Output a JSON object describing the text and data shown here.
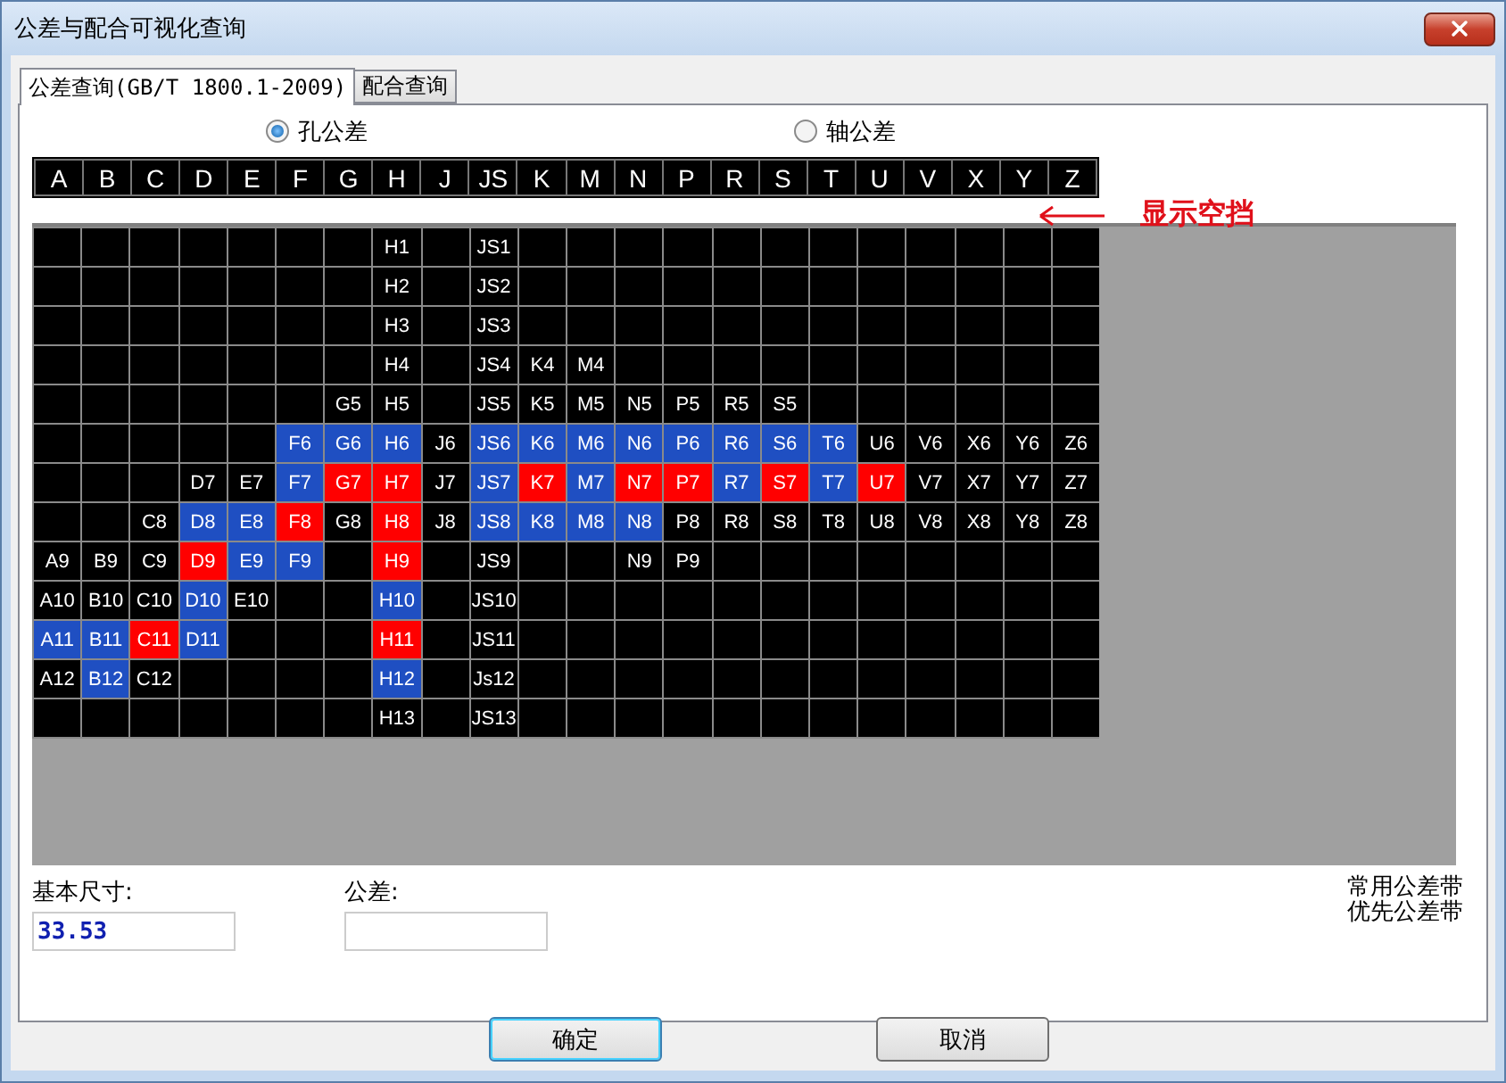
{
  "window": {
    "title": "公差与配合可视化查询"
  },
  "tabs": [
    {
      "label": "公差查询(GB/T 1800.1-2009)",
      "selected": true
    },
    {
      "label": "配合查询",
      "selected": false
    }
  ],
  "radios": [
    {
      "label": "孔公差",
      "selected": true
    },
    {
      "label": "轴公差",
      "selected": false
    }
  ],
  "letters": [
    "A",
    "B",
    "C",
    "D",
    "E",
    "F",
    "G",
    "H",
    "J",
    "JS",
    "K",
    "M",
    "N",
    "P",
    "R",
    "S",
    "T",
    "U",
    "V",
    "X",
    "Y",
    "Z"
  ],
  "annotation": {
    "text": "显示空挡"
  },
  "grid_rows": [
    [
      null,
      null,
      null,
      null,
      null,
      null,
      null,
      {
        "text": "H1",
        "color": "#000000"
      },
      null,
      {
        "text": "JS1",
        "color": "#000000"
      },
      null,
      null,
      null,
      null,
      null,
      null,
      null,
      null,
      null,
      null,
      null,
      null
    ],
    [
      null,
      null,
      null,
      null,
      null,
      null,
      null,
      {
        "text": "H2",
        "color": "#000000"
      },
      null,
      {
        "text": "JS2",
        "color": "#000000"
      },
      null,
      null,
      null,
      null,
      null,
      null,
      null,
      null,
      null,
      null,
      null,
      null
    ],
    [
      null,
      null,
      null,
      null,
      null,
      null,
      null,
      {
        "text": "H3",
        "color": "#000000"
      },
      null,
      {
        "text": "JS3",
        "color": "#000000"
      },
      null,
      null,
      null,
      null,
      null,
      null,
      null,
      null,
      null,
      null,
      null,
      null
    ],
    [
      null,
      null,
      null,
      null,
      null,
      null,
      null,
      {
        "text": "H4",
        "color": "#000000"
      },
      null,
      {
        "text": "JS4",
        "color": "#000000"
      },
      {
        "text": "K4",
        "color": "#000000"
      },
      {
        "text": "M4",
        "color": "#000000"
      },
      null,
      null,
      null,
      null,
      null,
      null,
      null,
      null,
      null,
      null
    ],
    [
      null,
      null,
      null,
      null,
      null,
      null,
      {
        "text": "G5",
        "color": "#000000"
      },
      {
        "text": "H5",
        "color": "#000000"
      },
      null,
      {
        "text": "JS5",
        "color": "#000000"
      },
      {
        "text": "K5",
        "color": "#000000"
      },
      {
        "text": "M5",
        "color": "#000000"
      },
      {
        "text": "N5",
        "color": "#000000"
      },
      {
        "text": "P5",
        "color": "#000000"
      },
      {
        "text": "R5",
        "color": "#000000"
      },
      {
        "text": "S5",
        "color": "#000000"
      },
      null,
      null,
      null,
      null,
      null,
      null
    ],
    [
      null,
      null,
      null,
      null,
      null,
      {
        "text": "F6",
        "color": "#1f4fc2"
      },
      {
        "text": "G6",
        "color": "#1f4fc2"
      },
      {
        "text": "H6",
        "color": "#1f4fc2"
      },
      {
        "text": "J6",
        "color": "#000000"
      },
      {
        "text": "JS6",
        "color": "#1f4fc2"
      },
      {
        "text": "K6",
        "color": "#1f4fc2"
      },
      {
        "text": "M6",
        "color": "#1f4fc2"
      },
      {
        "text": "N6",
        "color": "#1f4fc2"
      },
      {
        "text": "P6",
        "color": "#1f4fc2"
      },
      {
        "text": "R6",
        "color": "#1f4fc2"
      },
      {
        "text": "S6",
        "color": "#1f4fc2"
      },
      {
        "text": "T6",
        "color": "#1f4fc2"
      },
      {
        "text": "U6",
        "color": "#000000"
      },
      {
        "text": "V6",
        "color": "#000000"
      },
      {
        "text": "X6",
        "color": "#000000"
      },
      {
        "text": "Y6",
        "color": "#000000"
      },
      {
        "text": "Z6",
        "color": "#000000"
      }
    ],
    [
      null,
      null,
      null,
      {
        "text": "D7",
        "color": "#000000"
      },
      {
        "text": "E7",
        "color": "#000000"
      },
      {
        "text": "F7",
        "color": "#1f4fc2"
      },
      {
        "text": "G7",
        "color": "#ff0000"
      },
      {
        "text": "H7",
        "color": "#ff0000"
      },
      {
        "text": "J7",
        "color": "#000000"
      },
      {
        "text": "JS7",
        "color": "#1f4fc2"
      },
      {
        "text": "K7",
        "color": "#ff0000"
      },
      {
        "text": "M7",
        "color": "#1f4fc2"
      },
      {
        "text": "N7",
        "color": "#ff0000"
      },
      {
        "text": "P7",
        "color": "#ff0000"
      },
      {
        "text": "R7",
        "color": "#1f4fc2"
      },
      {
        "text": "S7",
        "color": "#ff0000"
      },
      {
        "text": "T7",
        "color": "#1f4fc2"
      },
      {
        "text": "U7",
        "color": "#ff0000"
      },
      {
        "text": "V7",
        "color": "#000000"
      },
      {
        "text": "X7",
        "color": "#000000"
      },
      {
        "text": "Y7",
        "color": "#000000"
      },
      {
        "text": "Z7",
        "color": "#000000"
      }
    ],
    [
      null,
      null,
      {
        "text": "C8",
        "color": "#000000"
      },
      {
        "text": "D8",
        "color": "#1f4fc2"
      },
      {
        "text": "E8",
        "color": "#1f4fc2"
      },
      {
        "text": "F8",
        "color": "#ff0000"
      },
      {
        "text": "G8",
        "color": "#000000"
      },
      {
        "text": "H8",
        "color": "#ff0000"
      },
      {
        "text": "J8",
        "color": "#000000"
      },
      {
        "text": "JS8",
        "color": "#1f4fc2"
      },
      {
        "text": "K8",
        "color": "#1f4fc2"
      },
      {
        "text": "M8",
        "color": "#1f4fc2"
      },
      {
        "text": "N8",
        "color": "#1f4fc2"
      },
      {
        "text": "P8",
        "color": "#000000"
      },
      {
        "text": "R8",
        "color": "#000000"
      },
      {
        "text": "S8",
        "color": "#000000"
      },
      {
        "text": "T8",
        "color": "#000000"
      },
      {
        "text": "U8",
        "color": "#000000"
      },
      {
        "text": "V8",
        "color": "#000000"
      },
      {
        "text": "X8",
        "color": "#000000"
      },
      {
        "text": "Y8",
        "color": "#000000"
      },
      {
        "text": "Z8",
        "color": "#000000"
      }
    ],
    [
      {
        "text": "A9",
        "color": "#000000"
      },
      {
        "text": "B9",
        "color": "#000000"
      },
      {
        "text": "C9",
        "color": "#000000"
      },
      {
        "text": "D9",
        "color": "#ff0000"
      },
      {
        "text": "E9",
        "color": "#1f4fc2"
      },
      {
        "text": "F9",
        "color": "#1f4fc2"
      },
      null,
      {
        "text": "H9",
        "color": "#ff0000"
      },
      null,
      {
        "text": "JS9",
        "color": "#000000"
      },
      null,
      null,
      {
        "text": "N9",
        "color": "#000000"
      },
      {
        "text": "P9",
        "color": "#000000"
      },
      null,
      null,
      null,
      null,
      null,
      null,
      null,
      null
    ],
    [
      {
        "text": "A10",
        "color": "#000000"
      },
      {
        "text": "B10",
        "color": "#000000"
      },
      {
        "text": "C10",
        "color": "#000000"
      },
      {
        "text": "D10",
        "color": "#1f4fc2"
      },
      {
        "text": "E10",
        "color": "#000000"
      },
      null,
      null,
      {
        "text": "H10",
        "color": "#1f4fc2"
      },
      null,
      {
        "text": "JS10",
        "color": "#000000"
      },
      null,
      null,
      null,
      null,
      null,
      null,
      null,
      null,
      null,
      null,
      null,
      null
    ],
    [
      {
        "text": "A11",
        "color": "#1f4fc2"
      },
      {
        "text": "B11",
        "color": "#1f4fc2"
      },
      {
        "text": "C11",
        "color": "#ff0000"
      },
      {
        "text": "D11",
        "color": "#1f4fc2"
      },
      null,
      null,
      null,
      {
        "text": "H11",
        "color": "#ff0000"
      },
      null,
      {
        "text": "JS11",
        "color": "#000000"
      },
      null,
      null,
      null,
      null,
      null,
      null,
      null,
      null,
      null,
      null,
      null,
      null
    ],
    [
      {
        "text": "A12",
        "color": "#000000"
      },
      {
        "text": "B12",
        "color": "#1f4fc2"
      },
      {
        "text": "C12",
        "color": "#000000"
      },
      null,
      null,
      null,
      null,
      {
        "text": "H12",
        "color": "#1f4fc2"
      },
      null,
      {
        "text": "Js12",
        "color": "#000000"
      },
      null,
      null,
      null,
      null,
      null,
      null,
      null,
      null,
      null,
      null,
      null,
      null
    ],
    [
      null,
      null,
      null,
      null,
      null,
      null,
      null,
      {
        "text": "H13",
        "color": "#000000"
      },
      null,
      {
        "text": "JS13",
        "color": "#000000"
      },
      null,
      null,
      null,
      null,
      null,
      null,
      null,
      null,
      null,
      null,
      null,
      null
    ]
  ],
  "fields": [
    {
      "label": "基本尺寸:",
      "value": "33.53"
    },
    {
      "label": "公差:"
    }
  ],
  "legend": [
    "常用公差带",
    "优先公差带"
  ],
  "buttons": [
    {
      "label": "确定",
      "default": true
    },
    {
      "label": "取消",
      "default": false
    }
  ]
}
